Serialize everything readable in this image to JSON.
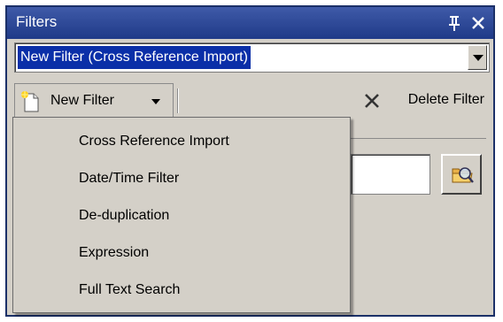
{
  "window": {
    "title": "Filters"
  },
  "filter_select": {
    "value": "New Filter (Cross Reference Import)"
  },
  "toolbar": {
    "new_filter_label": "New Filter",
    "delete_filter_label": "Delete Filter"
  },
  "menu": {
    "items": [
      {
        "label": "Cross Reference Import"
      },
      {
        "label": "Date/Time Filter"
      },
      {
        "label": "De-duplication"
      },
      {
        "label": "Expression"
      },
      {
        "label": "Full Text Search"
      }
    ]
  },
  "colors": {
    "title_bar": "#1f3a88",
    "selection": "#0a2fa8",
    "panel": "#d4d0c8"
  },
  "icons": [
    "pin-icon",
    "close-icon",
    "new-document-icon",
    "chevron-down-icon",
    "delete-x-icon",
    "browse-folder-icon"
  ]
}
